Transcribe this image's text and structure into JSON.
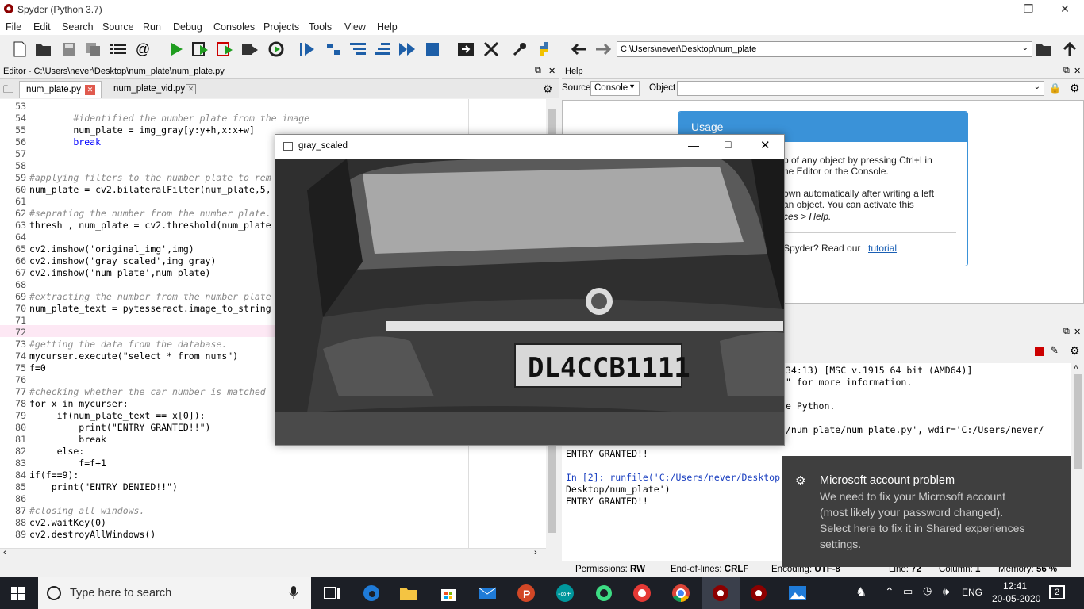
{
  "window": {
    "title": "Spyder (Python 3.7)"
  },
  "menu": [
    "File",
    "Edit",
    "Search",
    "Source",
    "Run",
    "Debug",
    "Consoles",
    "Projects",
    "Tools",
    "View",
    "Help"
  ],
  "toolbar": {
    "path": "C:\\Users\\never\\Desktop\\num_plate"
  },
  "editor": {
    "header": "Editor - C:\\Users\\never\\Desktop\\num_plate\\num_plate.py",
    "tabs": [
      "num_plate.py",
      "num_plate_vid.py"
    ],
    "lines": [
      {
        "n": "53",
        "t": ""
      },
      {
        "n": "54",
        "t": "        #identified the number plate from the image",
        "c": "cmt"
      },
      {
        "n": "55",
        "t": "        num_plate = img_gray[y:y+h,x:x+w]"
      },
      {
        "n": "56",
        "t": "        break",
        "c": "kw"
      },
      {
        "n": "57",
        "t": ""
      },
      {
        "n": "58",
        "t": ""
      },
      {
        "n": "59",
        "t": "#applying filters to the number plate to rem",
        "c": "cmt"
      },
      {
        "n": "60",
        "t": "num_plate = cv2.bilateralFilter(num_plate,5,"
      },
      {
        "n": "61",
        "t": ""
      },
      {
        "n": "62",
        "t": "#seprating the number from the number plate.",
        "c": "cmt"
      },
      {
        "n": "63",
        "t": "thresh , num_plate = cv2.threshold(num_plate"
      },
      {
        "n": "64",
        "t": ""
      },
      {
        "n": "65",
        "t": "cv2.imshow('original_img',img)"
      },
      {
        "n": "66",
        "t": "cv2.imshow('gray_scaled',img_gray)"
      },
      {
        "n": "67",
        "t": "cv2.imshow('num_plate',num_plate)"
      },
      {
        "n": "68",
        "t": ""
      },
      {
        "n": "69",
        "t": "#extracting the number from the number plate",
        "c": "cmt"
      },
      {
        "n": "70",
        "t": "num_plate_text = pytesseract.image_to_string"
      },
      {
        "n": "71",
        "t": ""
      },
      {
        "n": "72",
        "t": ""
      },
      {
        "n": "73",
        "t": "#getting the data from the database.",
        "c": "cmt"
      },
      {
        "n": "74",
        "t": "mycurser.execute(\"select * from nums\")"
      },
      {
        "n": "75",
        "t": "f=0"
      },
      {
        "n": "76",
        "t": ""
      },
      {
        "n": "77",
        "t": "#checking whether the car number is matched",
        "c": "cmt"
      },
      {
        "n": "78",
        "t": "for x in mycurser:"
      },
      {
        "n": "79",
        "t": "     if(num_plate_text == x[0]):"
      },
      {
        "n": "80",
        "t": "         print(\"ENTRY GRANTED!!\")"
      },
      {
        "n": "81",
        "t": "         break"
      },
      {
        "n": "82",
        "t": "     else:"
      },
      {
        "n": "83",
        "t": "         f=f+1"
      },
      {
        "n": "84",
        "t": "if(f==9):"
      },
      {
        "n": "85",
        "t": "    print(\"ENTRY DENIED!!\")"
      },
      {
        "n": "86",
        "t": ""
      },
      {
        "n": "87",
        "t": "#closing all windows.",
        "c": "cmt"
      },
      {
        "n": "88",
        "t": "cv2.waitKey(0)"
      },
      {
        "n": "89",
        "t": "cv2.destroyAllWindows()"
      }
    ]
  },
  "help": {
    "header": "Help",
    "source_label": "Source",
    "source_value": "Console",
    "object_label": "Object",
    "usage_title": "Usage",
    "usage_lines": [
      "p of any object by pressing Ctrl+I in",
      "he Editor or the Console.",
      "own automatically after writing a left",
      "an object. You can activate this",
      "ces > Help.",
      "Spyder? Read our"
    ],
    "usage_link": "tutorial"
  },
  "console": {
    "lines": [
      {
        "t": "34:13) [MSC v.1915 64 bit (AMD64)]",
        "x": 1
      },
      {
        "t": "\" for more information.",
        "x": 1
      },
      {
        "t": "",
        "x": 0
      },
      {
        "t": "e Python.",
        "x": 1
      },
      {
        "t": "",
        "x": 0
      },
      {
        "t": "/num_plate/num_plate.py', wdir='C:/Users/never/",
        "x": 1
      },
      {
        "t": "",
        "x": 0
      },
      {
        "t": "ENTRY GRANTED!!",
        "x": 0
      },
      {
        "t": "",
        "x": 0
      },
      {
        "t": "In [2]: runfile('C:/Users/never/Desktop",
        "x": 0
      },
      {
        "t": "Desktop/num_plate')",
        "x": 0
      },
      {
        "t": "ENTRY GRANTED!!",
        "x": 0
      }
    ]
  },
  "status": {
    "permissions_label": "Permissions:",
    "permissions": "RW",
    "eol_label": "End-of-lines:",
    "eol": "CRLF",
    "encoding_label": "Encoding:",
    "encoding": "UTF-8",
    "line_label": "Line:",
    "line": "72",
    "column_label": "Column:",
    "column": "1",
    "memory_label": "Memory:",
    "memory": "56 %"
  },
  "gray_window": {
    "title": "gray_scaled",
    "plate": "DL4CCB1111"
  },
  "toast": {
    "title": "Microsoft account problem",
    "body": [
      "We need to fix your Microsoft account",
      "(most likely your password changed).",
      "Select here to fix it in Shared experiences",
      "settings."
    ]
  },
  "taskbar": {
    "search_placeholder": "Type here to search",
    "lang": "ENG",
    "time": "12:41",
    "date": "20-05-2020",
    "notifications": "2"
  }
}
